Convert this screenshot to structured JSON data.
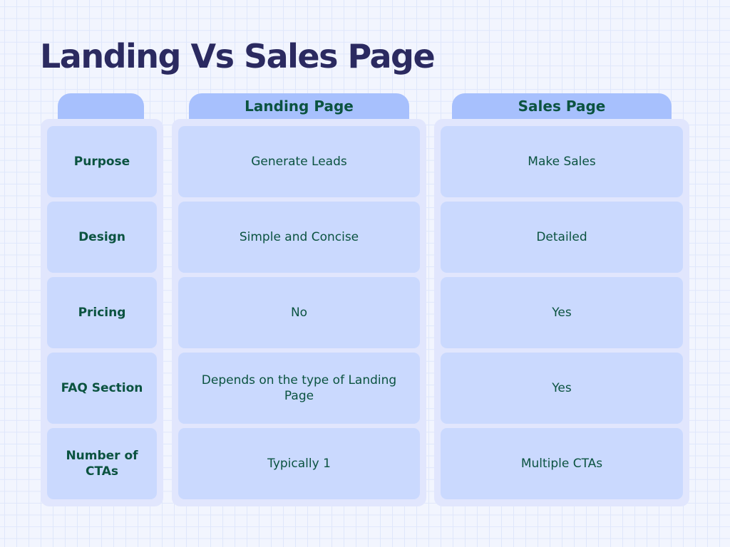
{
  "title": "Landing Vs Sales Page",
  "columns": {
    "label_header": "",
    "landing_header": "Landing Page",
    "sales_header": "Sales Page"
  },
  "rows": [
    {
      "label": "Purpose",
      "landing": "Generate Leads",
      "sales": "Make Sales"
    },
    {
      "label": "Design",
      "landing": "Simple and Concise",
      "sales": "Detailed"
    },
    {
      "label": "Pricing",
      "landing": "No",
      "sales": "Yes"
    },
    {
      "label": "FAQ Section",
      "landing": "Depends on the type of Landing Page",
      "sales": "Yes"
    },
    {
      "label": "Number of CTAs",
      "landing": "Typically 1",
      "sales": "Multiple CTAs"
    }
  ],
  "colors": {
    "title": "#2b2a60",
    "tab": "#a7c0fd",
    "column_bg": "#e1e6fd",
    "cell": "#cad9fe",
    "text": "#0b5340"
  }
}
